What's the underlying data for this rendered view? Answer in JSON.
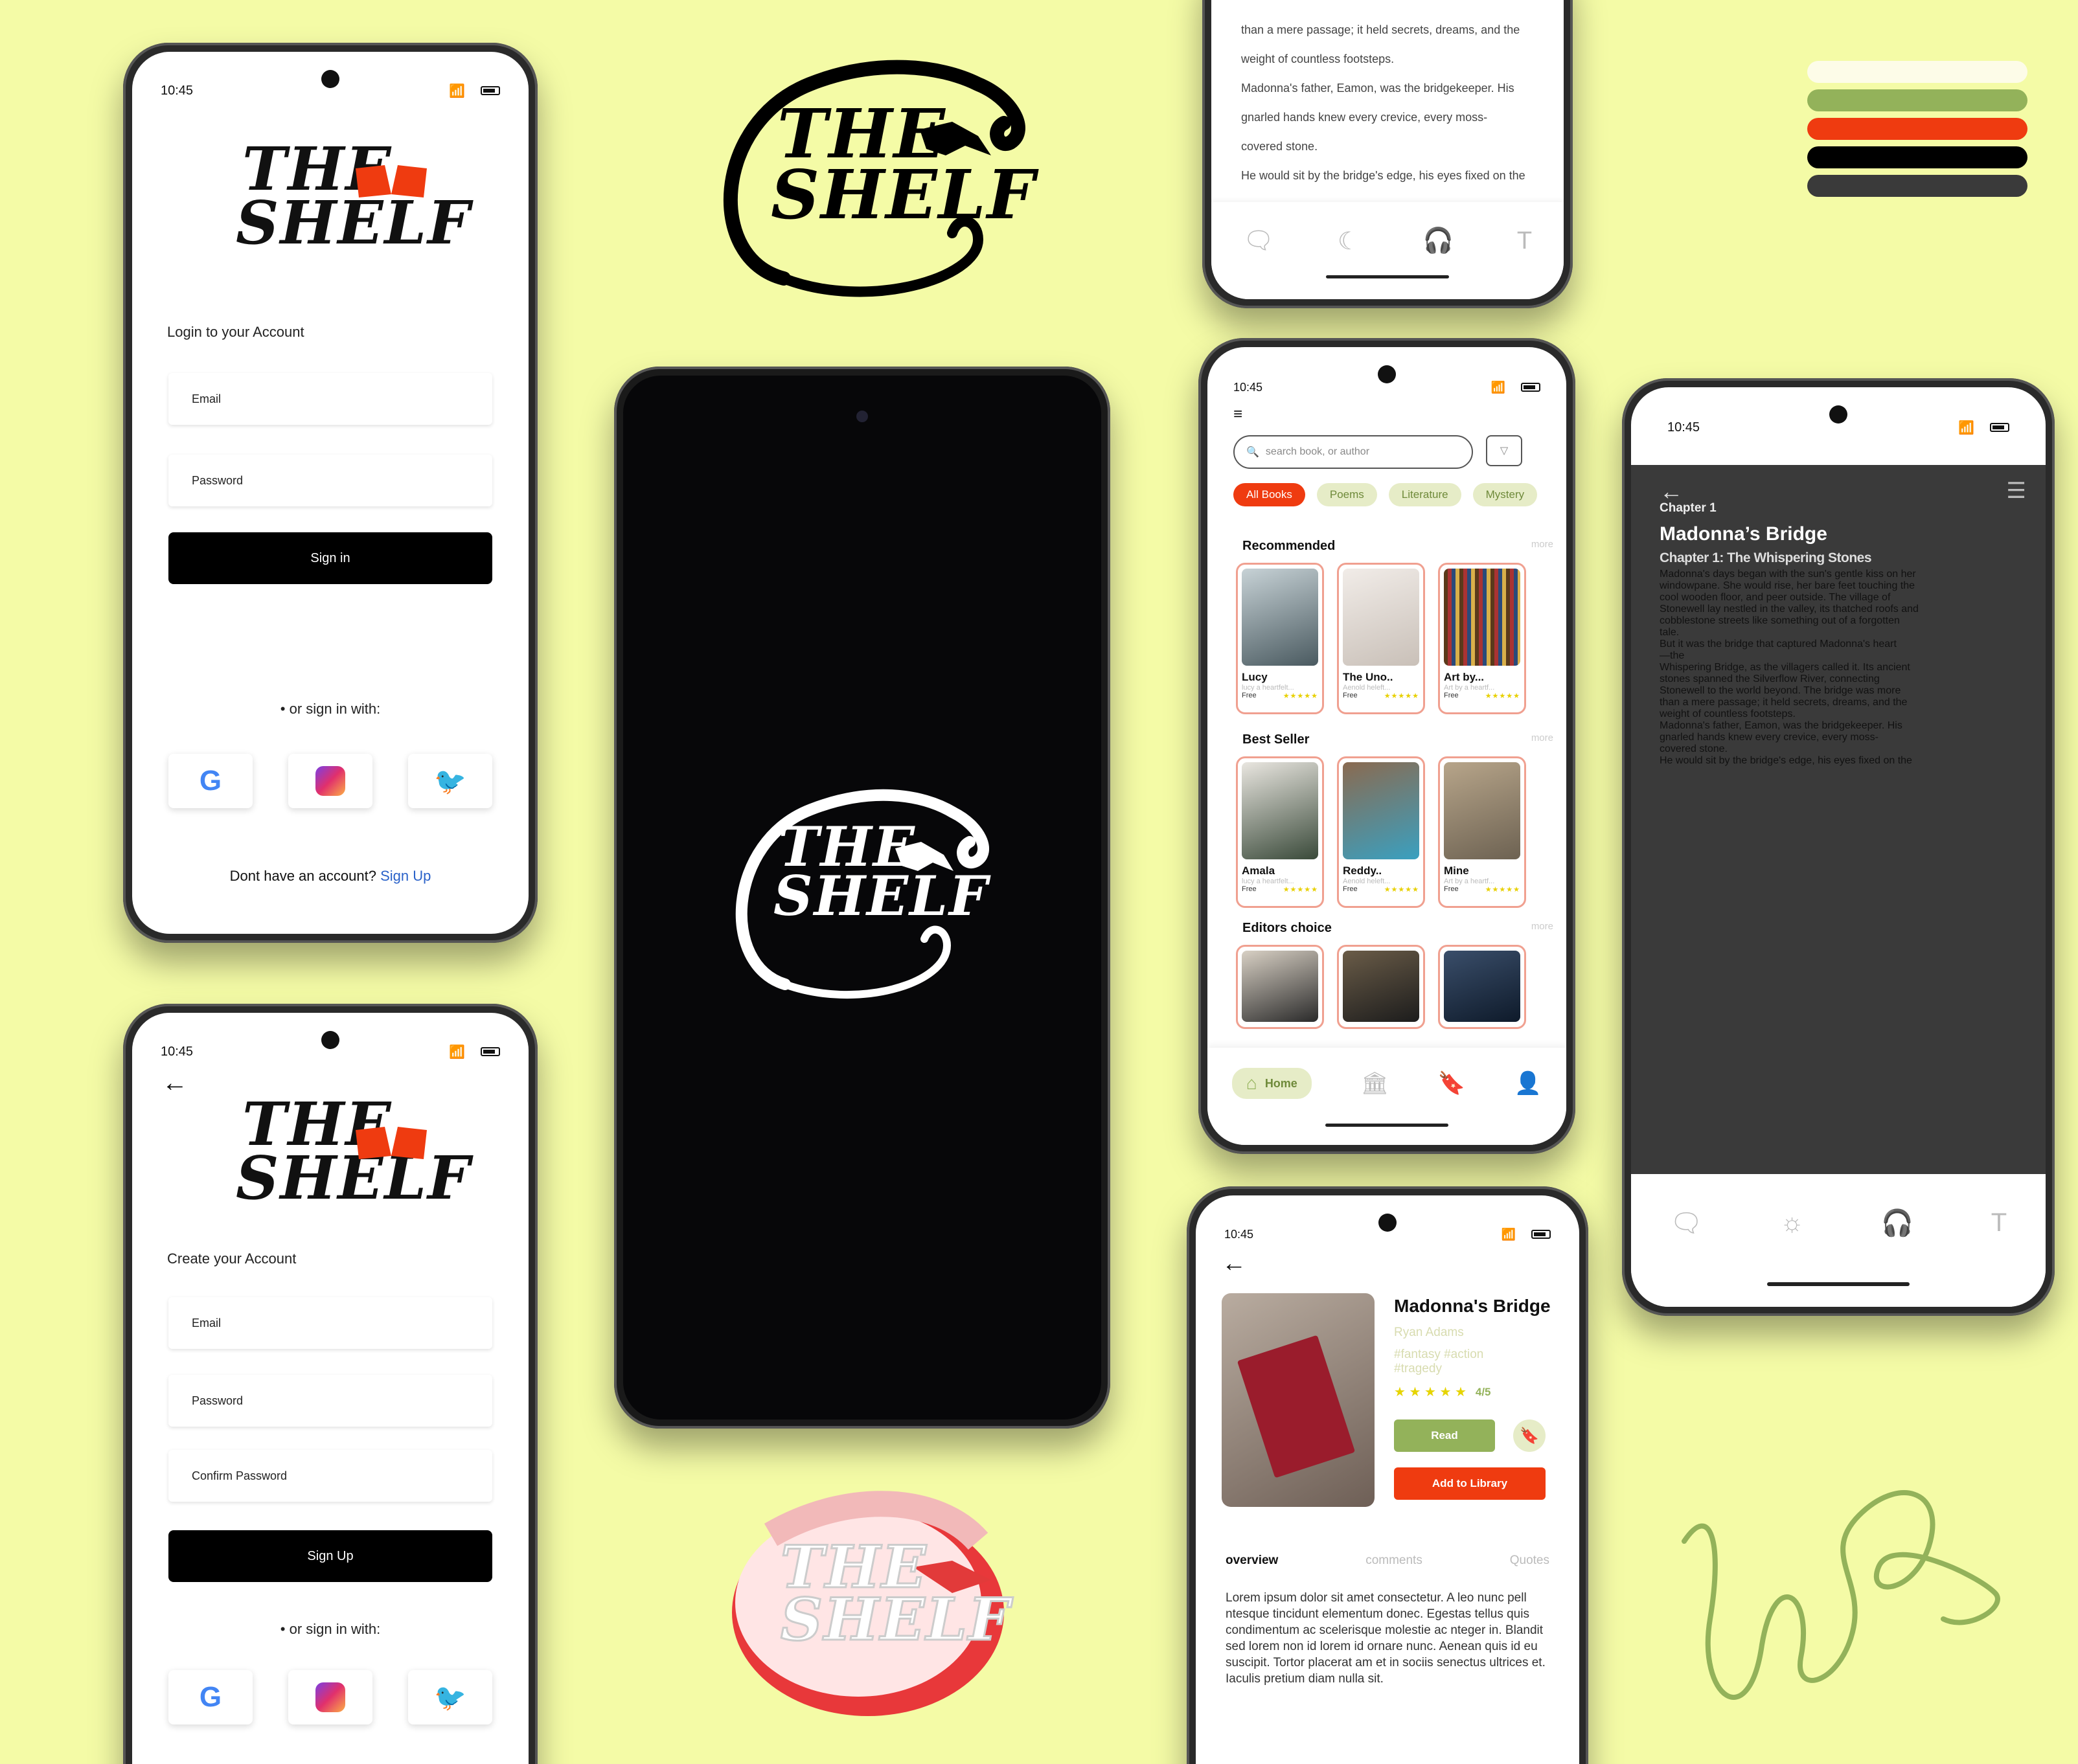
{
  "palette": [
    "#fdfce8",
    "#93b25a",
    "#ef3b10",
    "#000000",
    "#3a3a3a"
  ],
  "brand": {
    "line1": "THE",
    "line2": "SHELF",
    "accent": "#ef3b10"
  },
  "status_time": "10:45",
  "login": {
    "heading": "Login to your Account",
    "email_placeholder": "Email",
    "password_placeholder": "Password",
    "signin_label": "Sign in",
    "or_text": "• or sign in with:",
    "no_account": "Dont have an account?",
    "signup_link": "Sign Up"
  },
  "signup": {
    "heading": "Create your Account",
    "email_placeholder": "Email",
    "password_placeholder": "Password",
    "confirm_placeholder": "Confirm Password",
    "signup_label": "Sign  Up",
    "or_text": "• or sign in with:"
  },
  "home": {
    "search_placeholder": "search book, or author",
    "chips": [
      "All Books",
      "Poems",
      "Literature",
      "Mystery"
    ],
    "recommended_title": "Recommended",
    "bestseller_title": "Best Seller",
    "editors_title": "Editors choice",
    "more": "more",
    "recommended": [
      {
        "title": "Lucy",
        "sub": "lucy a heartfelt...",
        "price": "Free"
      },
      {
        "title": "The Uno..",
        "sub": "Aenold heleft...",
        "price": "Free"
      },
      {
        "title": "Art by...",
        "sub": "Art by a heartf...",
        "price": "Free"
      }
    ],
    "bestseller": [
      {
        "title": "Amala",
        "sub": "lucy a heartfelt...",
        "price": "Free"
      },
      {
        "title": "Reddy..",
        "sub": "Aenold heleft...",
        "price": "Free"
      },
      {
        "title": "Mine",
        "sub": "Art by a heartf...",
        "price": "Free"
      }
    ],
    "nav_home": "Home"
  },
  "reader_top": {
    "lines": [
      "than a mere passage; it held secrets, dreams, and the",
      "weight of countless footsteps.",
      "Madonna's father, Eamon, was the bridgekeeper. His",
      "gnarled  hands knew every crevice, every moss-",
      "covered stone.",
      "He would sit by the bridge's edge, his eyes fixed on the"
    ]
  },
  "reader": {
    "chapter": "Chapter 1",
    "title": "Madonna’s Bridge",
    "subtitle": "Chapter 1: The Whispering Stones",
    "lines": [
      "Madonna's days began with the sun's gentle kiss on her",
      "windowpane. She would rise, her bare feet touching the",
      "cool wooden floor, and peer outside. The village of",
      "Stonewell lay nestled in the valley, its thatched roofs and",
      "cobblestone streets like something out of a forgotten",
      "tale.",
      "But it was the bridge that captured Madonna's heart",
      "—the",
      "Whispering Bridge, as the villagers called it. Its ancient",
      "stones spanned the Silverflow River, connecting",
      " Stonewell to the world beyond. The bridge was more",
      "than a mere passage; it held secrets, dreams, and the",
      " weight of countless footsteps.",
      "Madonna's father, Eamon, was the bridgekeeper. His",
      "gnarled  hands knew every crevice, every moss-",
      "covered stone.",
      "He would sit by the bridge's edge, his eyes fixed on the"
    ]
  },
  "detail": {
    "title": "Madonna's Bridge",
    "author": "Ryan Adams",
    "tags": "#fantasy #action\n#tragedy",
    "rating": "4/5",
    "stars": "★ ★ ★ ★ ★",
    "read_label": "Read",
    "add_label": "Add to Library",
    "tabs": [
      "overview",
      "comments",
      "Quotes"
    ],
    "body": "Lorem ipsum dolor sit amet consectetur. A leo nunc pell ntesque tincidunt elementum donec. Egestas tellus quis condimentum ac scelerisque molestie ac nteger in. Blandit sed lorem non id lorem id ornare nunc. Aenean quis id eu suscipit. Tortor placerat am et in sociis senectus ultrices et. Iaculis pretium diam nulla sit."
  }
}
